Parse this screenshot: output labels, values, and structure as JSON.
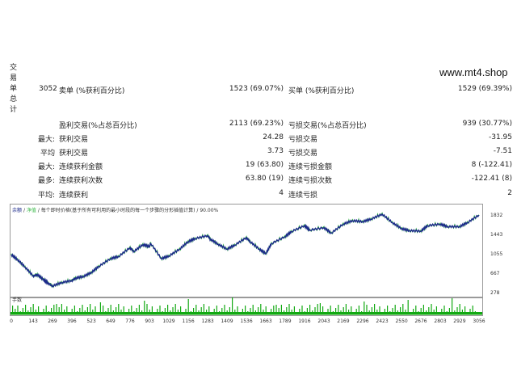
{
  "watermark": "www.mt4.shop",
  "side_title": [
    "交",
    "易",
    "单",
    "总",
    "计"
  ],
  "stats": {
    "total_trades": "3052",
    "short_label": "卖单 (%获利百分比)",
    "short_value": "1523 (69.07%)",
    "long_label": "买单 (%获利百分比)",
    "long_value": "1529 (69.39%)",
    "profit_label": "盈利交易(%占总百分比)",
    "profit_value": "2113 (69.23%)",
    "loss_label": "亏损交易(%占总百分比)",
    "loss_value": "939 (30.77%)",
    "largest_prefix": "最大:",
    "largest_profit_label": "获利交易",
    "largest_profit_value": "24.28",
    "largest_loss_label": "亏损交易",
    "largest_loss_value": "-31.95",
    "average_prefix": "平均",
    "average_profit_label": "获利交易",
    "average_profit_value": "3.73",
    "average_loss_label": "亏损交易",
    "average_loss_value": "-7.51",
    "max_prefix": "最大:",
    "max_consec_wins_label": "连续获利金额",
    "max_consec_wins_value": "19 (63.80)",
    "max_consec_losses_label": "连续亏损金额",
    "max_consec_losses_value": "8 (-122.41)",
    "maximal_prefix": "最多:",
    "maximal_consec_profit_label": "连续获利次数",
    "maximal_consec_profit_value": "63.80 (19)",
    "maximal_consec_loss_label": "连续亏损次数",
    "maximal_consec_loss_value": "-122.41 (8)",
    "avg_prefix": "平均:",
    "avg_consec_wins_label": "连续获利",
    "avg_consec_wins_value": "4",
    "avg_consec_losses_label": "连续亏损",
    "avg_consec_losses_value": "2"
  },
  "chart_header": {
    "balance": "余额",
    "sep1": "/",
    "equity": "净值",
    "sep2": "/",
    "model": "每个即时价格(基于所有可利用的最小时段的每一个步骤的分形插值计算)",
    "sep3": "/",
    "quality": "90.00%"
  },
  "volume_label": "手数",
  "colors": {
    "balance": "#1c2a8a",
    "equity": "#3bb84a",
    "volume": "#12a912",
    "frame": "#9a9a9a"
  },
  "chart_data": {
    "type": "line",
    "title": "",
    "xlabel": "",
    "ylabel": "",
    "x_ticks": [
      0,
      143,
      269,
      396,
      523,
      649,
      776,
      903,
      1029,
      1156,
      1283,
      1409,
      1536,
      1663,
      1789,
      1916,
      2043,
      2169,
      2296,
      2423,
      2550,
      2676,
      2803,
      2929,
      3056
    ],
    "y_ticks": [
      278,
      667,
      1055,
      1443,
      1832
    ],
    "xlim": [
      0,
      3056
    ],
    "ylim": [
      278,
      1832
    ],
    "series": [
      {
        "name": "余额",
        "x": [
          0,
          40,
          90,
          143,
          170,
          210,
          240,
          269,
          330,
          396,
          420,
          470,
          523,
          570,
          649,
          700,
          776,
          800,
          860,
          903,
          910,
          980,
          1029,
          1100,
          1156,
          1200,
          1283,
          1300,
          1350,
          1409,
          1460,
          1536,
          1560,
          1620,
          1663,
          1700,
          1789,
          1830,
          1916,
          1950,
          2043,
          2090,
          2169,
          2230,
          2296,
          2350,
          2423,
          2490,
          2550,
          2600,
          2676,
          2720,
          2803,
          2850,
          2929,
          2980,
          3056
        ],
        "y": [
          1040,
          940,
          790,
          610,
          640,
          540,
          470,
          410,
          480,
          520,
          570,
          600,
          680,
          800,
          960,
          1000,
          1180,
          1100,
          1240,
          1200,
          1270,
          960,
          1010,
          1150,
          1300,
          1360,
          1420,
          1350,
          1250,
          1150,
          1230,
          1380,
          1300,
          1150,
          1060,
          1260,
          1400,
          1500,
          1620,
          1530,
          1580,
          1470,
          1650,
          1720,
          1700,
          1750,
          1850,
          1680,
          1560,
          1520,
          1510,
          1620,
          1650,
          1600,
          1600,
          1680,
          1832
        ]
      }
    ]
  }
}
